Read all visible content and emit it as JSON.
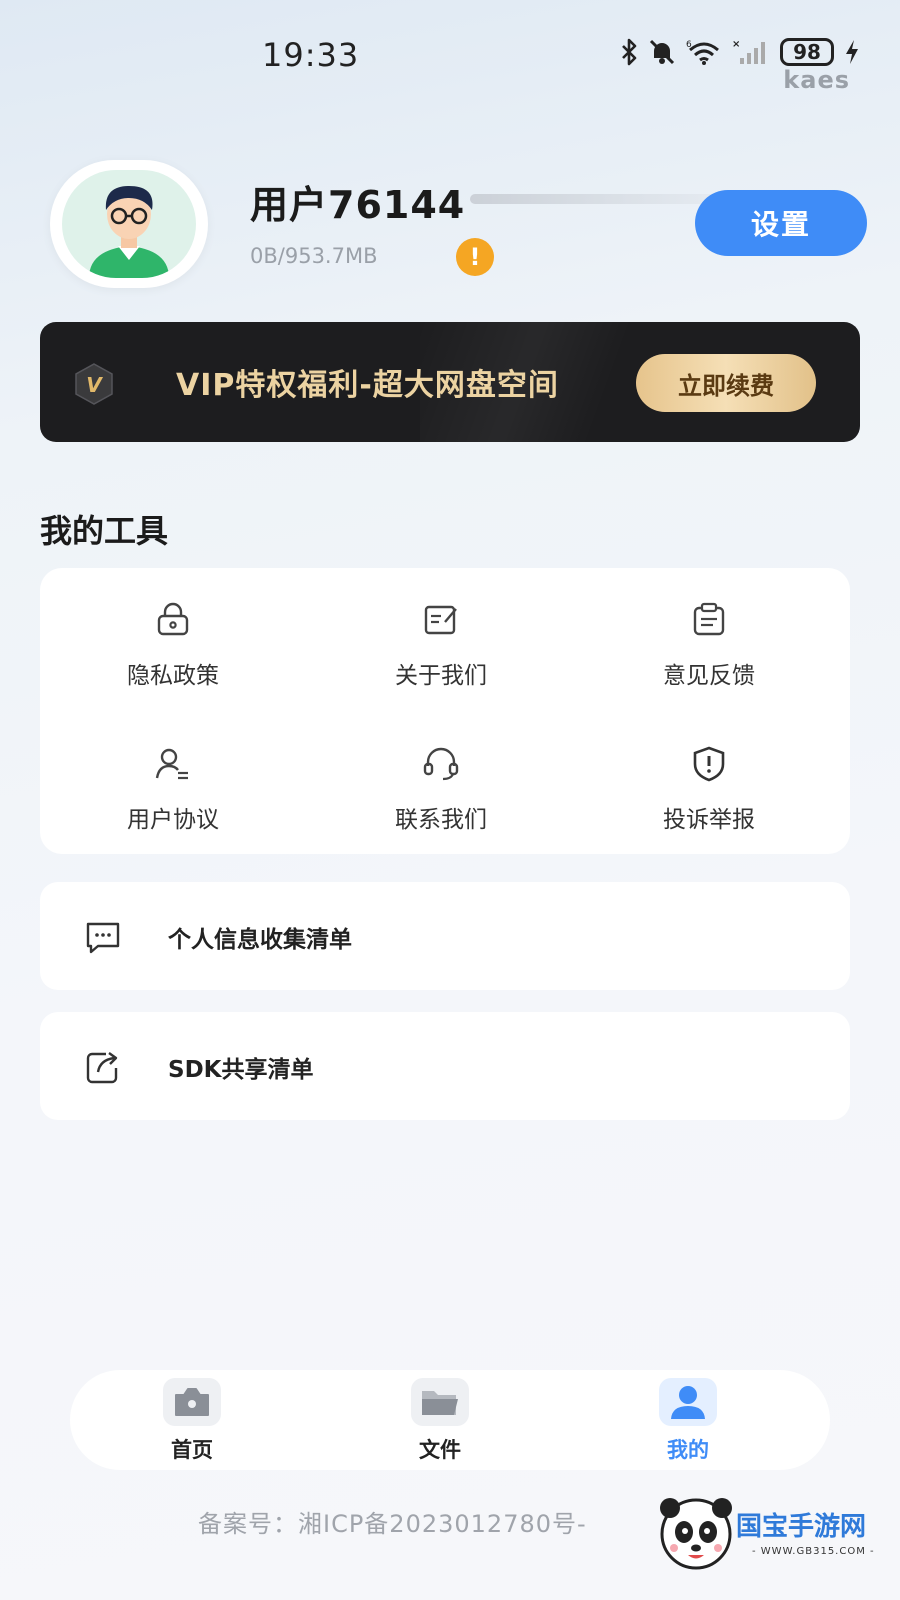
{
  "status_bar": {
    "time": "19:33",
    "battery": "98",
    "brand": "kaes",
    "icons": [
      "bluetooth-icon",
      "mute-bell-icon",
      "wifi-icon",
      "signal-icon",
      "battery-icon",
      "charging-icon"
    ]
  },
  "profile": {
    "username": "用户76144",
    "storage": "0B/953.7MB",
    "warning_badge": "!",
    "settings_label": "设置"
  },
  "vip_banner": {
    "badge": "V",
    "text": "VIP特权福利-超大网盘空间",
    "button": "立即续费"
  },
  "tools": {
    "title": "我的工具",
    "items": [
      {
        "label": "隐私政策",
        "icon": "lock-icon"
      },
      {
        "label": "关于我们",
        "icon": "edit-note-icon"
      },
      {
        "label": "意见反馈",
        "icon": "clipboard-icon"
      },
      {
        "label": "用户协议",
        "icon": "user-doc-icon"
      },
      {
        "label": "联系我们",
        "icon": "headset-icon"
      },
      {
        "label": "投诉举报",
        "icon": "shield-alert-icon"
      }
    ]
  },
  "lists": [
    {
      "label": "个人信息收集清单",
      "icon": "chat-dots-icon"
    },
    {
      "label": "SDK共享清单",
      "icon": "share-icon"
    }
  ],
  "tabbar": {
    "items": [
      {
        "label": "首页",
        "icon": "home-camera-icon",
        "active": false
      },
      {
        "label": "文件",
        "icon": "folder-icon",
        "active": false
      },
      {
        "label": "我的",
        "icon": "person-icon",
        "active": true
      }
    ]
  },
  "footer": {
    "icp": "备案号：湘ICP备2023012780号-"
  },
  "watermark": {
    "name": "国宝手游网",
    "url": "- WWW.GB315.COM -"
  },
  "colors": {
    "accent": "#3f8cf7",
    "vip_bg": "#1d1d1f",
    "vip_gold": "#ecd3a2",
    "warning": "#f5a623"
  }
}
